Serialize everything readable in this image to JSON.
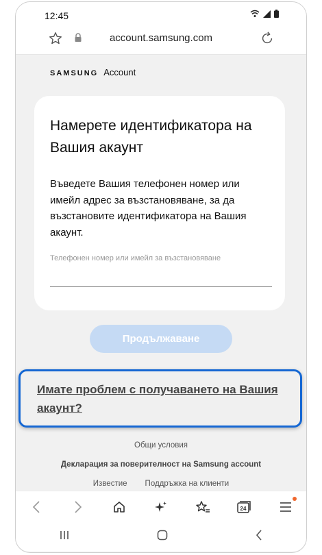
{
  "status": {
    "time": "12:45"
  },
  "browser": {
    "url": "account.samsung.com"
  },
  "brand": {
    "logo": "SAMSUNG",
    "name": "Account"
  },
  "card": {
    "title": "Намерете идентификатора на Вашия акаунт",
    "description": "Въведете Вашия телефонен номер или имейл адрес за възстановяване, за да възстановите идентификатора на Вашия акаунт.",
    "input_placeholder": "Телефонен номер или имейл за възстановяване"
  },
  "continue_label": "Продължаване",
  "help_link": "Имате проблем с получаването на Вашия акаунт?",
  "footer": {
    "terms": "Общи условия",
    "privacy": "Декларация за поверителност на Samsung account",
    "notice": "Известие",
    "support": "Поддръжка на клиенти"
  },
  "toolbar": {
    "tabs_count": "24"
  },
  "colors": {
    "accent": "#1567d3",
    "button_disabled": "#c5daf4",
    "notification_dot": "#f0672d"
  }
}
